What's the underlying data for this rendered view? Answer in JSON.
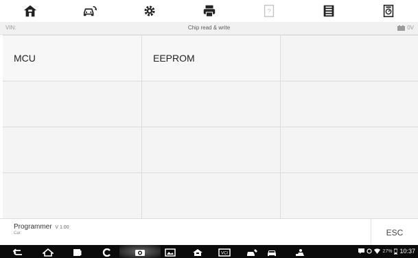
{
  "toolbar": {
    "items": [
      {
        "name": "home-icon"
      },
      {
        "name": "vehicle-swap-icon"
      },
      {
        "name": "settings-gear-icon"
      },
      {
        "name": "print-icon"
      },
      {
        "name": "help-icon",
        "disabled": true
      },
      {
        "name": "save-icon"
      },
      {
        "name": "data-logging-icon"
      }
    ]
  },
  "infobar": {
    "vin_label": "VIN:",
    "title": "Chip read & write",
    "voltage": "0V"
  },
  "grid": {
    "cells": [
      "MCU",
      "EEPROM",
      "",
      "",
      "",
      "",
      "",
      "",
      "",
      "",
      "",
      ""
    ]
  },
  "footer": {
    "program_name": "Programmer",
    "version": "V 1.00",
    "car_label": "Car:",
    "esc_label": "ESC"
  },
  "system_bar": {
    "battery": "27%",
    "time": "10:37"
  },
  "colors": {
    "navbar_bg": "#0b0b0b",
    "grid_bg": "#f4f4f4",
    "accent": "#222222"
  }
}
